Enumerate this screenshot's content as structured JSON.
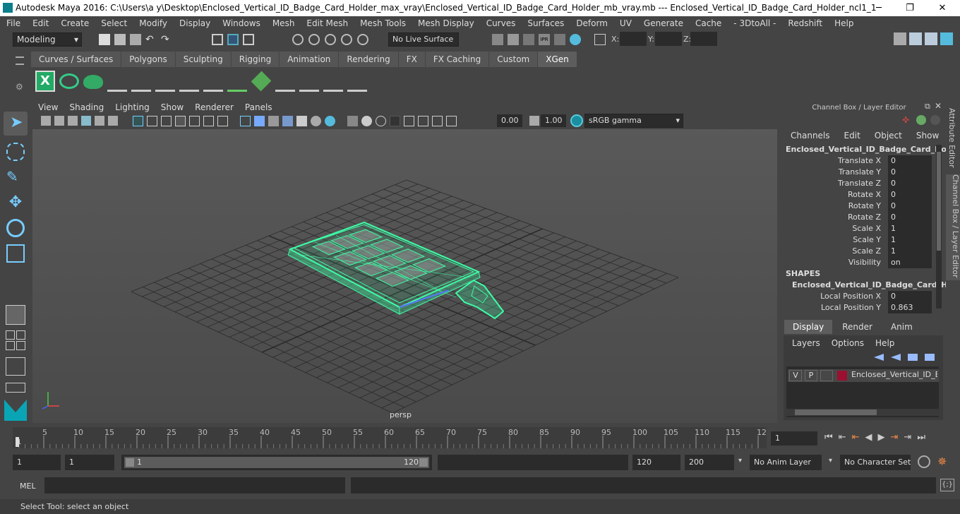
{
  "window": {
    "title": "Autodesk Maya 2016: C:\\Users\\a y\\Desktop\\Enclosed_Vertical_ID_Badge_Card_Holder_max_vray\\Enclosed_Vertical_ID_Badge_Card_Holder_mb_vray.mb   ---   Enclosed_Vertical_ID_Badge_Card_Holder_ncl1_1",
    "minimize": "─",
    "maximize": "❐",
    "close": "✕"
  },
  "menubar": [
    "File",
    "Edit",
    "Create",
    "Select",
    "Modify",
    "Display",
    "Windows",
    "Mesh",
    "Edit Mesh",
    "Mesh Tools",
    "Mesh Display",
    "Curves",
    "Surfaces",
    "Deform",
    "UV",
    "Generate",
    "Cache",
    "- 3DtoAll -",
    "Redshift",
    "Help"
  ],
  "statusline": {
    "mode": "Modeling",
    "live_surface": "No Live Surface",
    "x_label": "X:",
    "y_label": "Y:",
    "z_label": "Z:"
  },
  "shelf_tabs": [
    "Curves / Surfaces",
    "Polygons",
    "Sculpting",
    "Rigging",
    "Animation",
    "Rendering",
    "FX",
    "FX Caching",
    "Custom",
    "XGen"
  ],
  "shelf_active": "XGen",
  "viewport_menu": [
    "View",
    "Shading",
    "Lighting",
    "Show",
    "Renderer",
    "Panels"
  ],
  "viewport_toolbar": {
    "field1": "0.00",
    "field2": "1.00",
    "colorspace": "sRGB gamma"
  },
  "viewport": {
    "camera_label": "persp",
    "grid_color": "#2a2a2a",
    "selection_color": "#3dfca6"
  },
  "channel_box": {
    "title": "Channel Box / Layer Editor",
    "menu": [
      "Channels",
      "Edit",
      "Object",
      "Show"
    ],
    "object_name": "Enclosed_Vertical_ID_Badge_Card_Hol...",
    "channels": [
      {
        "label": "Translate X",
        "value": "0"
      },
      {
        "label": "Translate Y",
        "value": "0"
      },
      {
        "label": "Translate Z",
        "value": "0"
      },
      {
        "label": "Rotate X",
        "value": "0"
      },
      {
        "label": "Rotate Y",
        "value": "0"
      },
      {
        "label": "Rotate Z",
        "value": "0"
      },
      {
        "label": "Scale X",
        "value": "1"
      },
      {
        "label": "Scale Y",
        "value": "1"
      },
      {
        "label": "Scale Z",
        "value": "1"
      },
      {
        "label": "Visibility",
        "value": "on"
      }
    ],
    "shapes_header": "SHAPES",
    "shape_name": "Enclosed_Vertical_ID_Badge_Card_H...",
    "shape_channels": [
      {
        "label": "Local Position X",
        "value": "0"
      },
      {
        "label": "Local Position Y",
        "value": "0.863"
      }
    ]
  },
  "layer_editor": {
    "tabs": [
      "Display",
      "Render",
      "Anim"
    ],
    "active_tab": "Display",
    "menu": [
      "Layers",
      "Options",
      "Help"
    ],
    "layer": {
      "v": "V",
      "p": "P",
      "name": "Enclosed_Vertical_ID_Bad",
      "color": "#9b1030"
    }
  },
  "side_tabs": {
    "attribute_editor": "Attribute Editor",
    "channel_box": "Channel Box / Layer Editor"
  },
  "timeline": {
    "ticks": [
      "5",
      "10",
      "15",
      "20",
      "25",
      "30",
      "35",
      "40",
      "45",
      "50",
      "55",
      "60",
      "65",
      "70",
      "75",
      "80",
      "85",
      "90",
      "95",
      "100",
      "105",
      "110",
      "115",
      "12"
    ],
    "start_marker": "1",
    "current_frame": "1"
  },
  "range": {
    "start": "1",
    "start2": "1",
    "slider_start": "1",
    "slider_end": "120",
    "end": "120",
    "end2": "200",
    "anim_layer": "No Anim Layer",
    "character_set": "No Character Set"
  },
  "mel": {
    "label": "MEL"
  },
  "help_line": "Select Tool: select an object"
}
